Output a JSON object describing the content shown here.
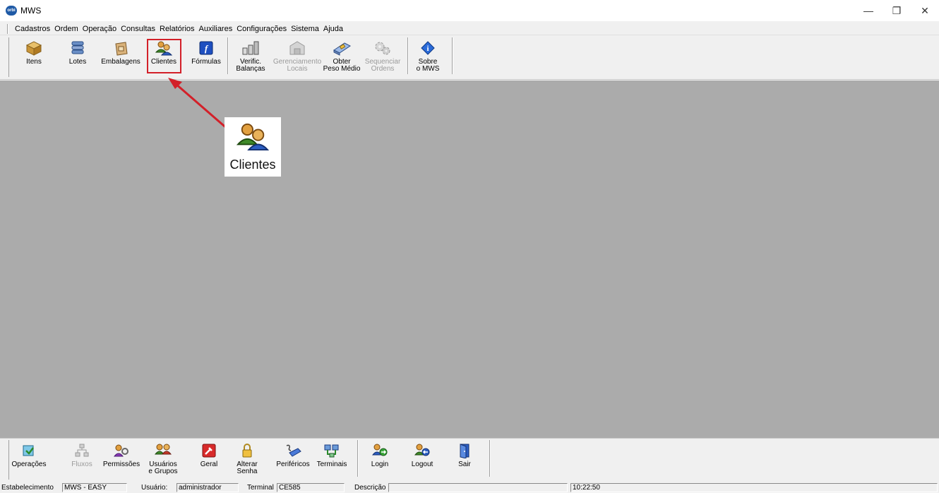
{
  "window": {
    "title": "MWS",
    "app_icon_text": "orbi",
    "controls": {
      "minimize": "—",
      "restore": "❐",
      "close": "✕"
    }
  },
  "menu": [
    "Cadastros",
    "Ordem",
    "Operação",
    "Consultas",
    "Relatórios",
    "Auxiliares",
    "Configurações",
    "Sistema",
    "Ajuda"
  ],
  "toolbar_top": {
    "items": [
      {
        "line1": "Itens",
        "line2": "",
        "icon": "box-icon",
        "enabled": true
      },
      {
        "line1": "Lotes",
        "line2": "",
        "icon": "stack-icon",
        "enabled": true
      },
      {
        "line1": "Embalagens",
        "line2": "",
        "icon": "bag-icon",
        "enabled": true
      },
      {
        "line1": "Clientes",
        "line2": "",
        "icon": "clients-icon",
        "enabled": true
      },
      {
        "line1": "Fórmulas",
        "line2": "",
        "icon": "formula-icon",
        "enabled": true
      },
      {
        "line1": "Verific.",
        "line2": "Balanças",
        "icon": "scale-icon",
        "enabled": true
      },
      {
        "line1": "Gerenciamento",
        "line2": "Locais",
        "icon": "warehouse-icon",
        "enabled": false
      },
      {
        "line1": "Obter",
        "line2": "Peso Médio",
        "icon": "weight-icon",
        "enabled": true
      },
      {
        "line1": "Sequenciar",
        "line2": "Ordens",
        "icon": "gears-icon",
        "enabled": false
      },
      {
        "line1": "Sobre",
        "line2": "o MWS",
        "icon": "info-icon",
        "enabled": true
      }
    ]
  },
  "callout": {
    "label": "Clientes"
  },
  "toolbar_bottom": {
    "items": [
      {
        "line1": "Operações",
        "line2": "",
        "icon": "operations-icon",
        "enabled": true
      },
      {
        "line1": "Fluxos",
        "line2": "",
        "icon": "flow-icon",
        "enabled": false
      },
      {
        "line1": "Permissões",
        "line2": "",
        "icon": "permissions-icon",
        "enabled": true
      },
      {
        "line1": "Usuários",
        "line2": "e Grupos",
        "icon": "users-icon",
        "enabled": true
      },
      {
        "line1": "Geral",
        "line2": "",
        "icon": "general-icon",
        "enabled": true
      },
      {
        "line1": "Alterar",
        "line2": "Senha",
        "icon": "lock-icon",
        "enabled": true
      },
      {
        "line1": "Periféricos",
        "line2": "",
        "icon": "peripherals-icon",
        "enabled": true
      },
      {
        "line1": "Terminais",
        "line2": "",
        "icon": "terminals-icon",
        "enabled": true
      },
      {
        "line1": "Login",
        "line2": "",
        "icon": "login-icon",
        "enabled": true
      },
      {
        "line1": "Logout",
        "line2": "",
        "icon": "logout-icon",
        "enabled": true
      },
      {
        "line1": "Sair",
        "line2": "",
        "icon": "exit-door-icon",
        "enabled": true
      }
    ]
  },
  "status": {
    "estabelecimento_label": "Estabelecimento",
    "estabelecimento_value": "MWS - EASY",
    "usuario_label": "Usuário:",
    "usuario_value": "administrador",
    "terminal_label": "Terminal",
    "terminal_value": "CE585",
    "descricao_label": "Descrição",
    "descricao_value": "",
    "time": "10:22:50"
  },
  "colors": {
    "workspace": "#ababab",
    "highlight": "#d32029",
    "arrow": "#d32029"
  }
}
